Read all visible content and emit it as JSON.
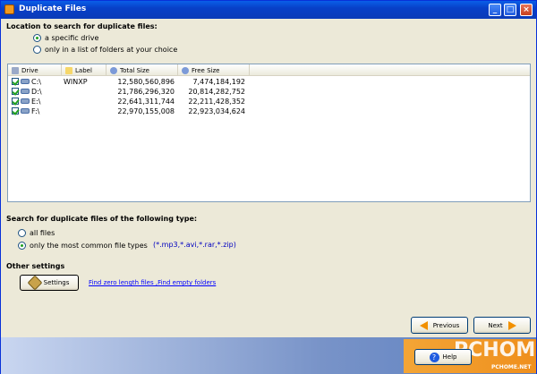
{
  "window": {
    "title": "Duplicate Files"
  },
  "location": {
    "label": "Location to search for duplicate files:",
    "options": [
      "a specific drive",
      "only in a list of folders at your choice"
    ],
    "selected_index": 0
  },
  "drives": {
    "columns": [
      "Drive",
      "Label",
      "Total Size",
      "Free Size"
    ],
    "rows": [
      {
        "drive": "C:\\",
        "label": "WINXP",
        "total": "12,580,560,896",
        "free": "7,474,184,192",
        "checked": true
      },
      {
        "drive": "D:\\",
        "label": "",
        "total": "21,786,296,320",
        "free": "20,814,282,752",
        "checked": true
      },
      {
        "drive": "E:\\",
        "label": "",
        "total": "22,641,311,744",
        "free": "22,211,428,352",
        "checked": true
      },
      {
        "drive": "F:\\",
        "label": "",
        "total": "22,970,155,008",
        "free": "22,923,034,624",
        "checked": true
      }
    ]
  },
  "filetype": {
    "label": "Search for duplicate files of the following type:",
    "options": [
      "all files",
      "only the most common file types"
    ],
    "selected_index": 1,
    "extensions": "(*.mp3,*.avi,*.rar,*.zip)"
  },
  "other": {
    "label": "Other settings",
    "settings_button": "Settings",
    "link": "Find zero length files ,Find empty folders"
  },
  "nav": {
    "previous": "Previous",
    "next": "Next",
    "help": "Help"
  },
  "watermark": {
    "brand": "PCHOME",
    "url": "PCHOME.NET"
  },
  "colors": {
    "titlebar": "#0a5fe8",
    "link": "#0000ff",
    "accent": "#f29000"
  },
  "icons": {
    "app": "app-icon",
    "drive": "drive-icon",
    "settings": "wrench-icon",
    "help": "question-icon"
  }
}
